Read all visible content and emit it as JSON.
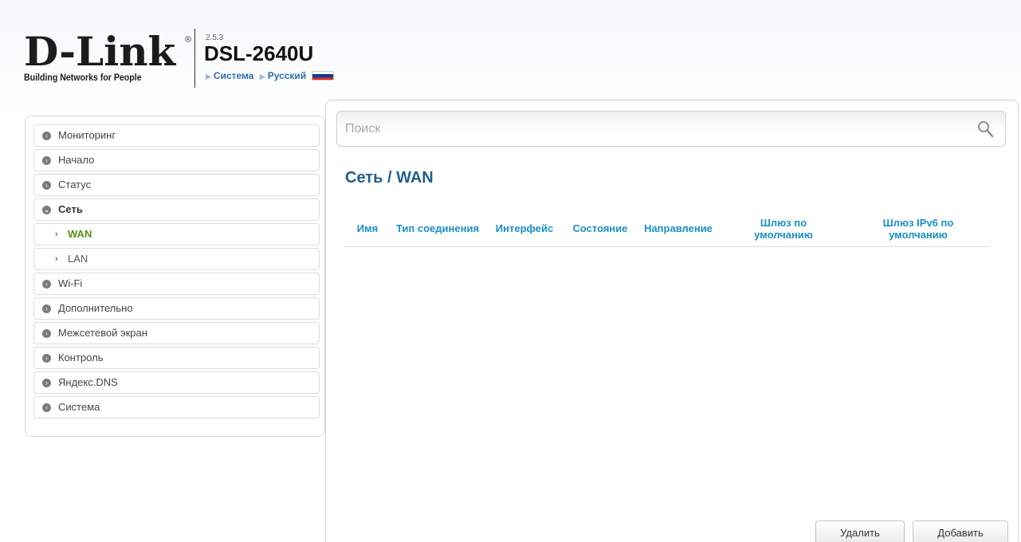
{
  "header": {
    "logo_text": "D-Link",
    "logo_reg": "®",
    "tagline": "Building Networks for People",
    "version": "2.5.3",
    "model": "DSL-2640U",
    "nav": [
      {
        "label": "Система"
      },
      {
        "label": "Русский"
      }
    ],
    "flag_colors": [
      "#ffffff",
      "#0039a6",
      "#d52b1e"
    ]
  },
  "sidebar": {
    "items": [
      {
        "label": "Мониторинг"
      },
      {
        "label": "Начало"
      },
      {
        "label": "Статус"
      },
      {
        "label": "Сеть"
      },
      {
        "label": "WAN"
      },
      {
        "label": "LAN"
      },
      {
        "label": "Wi-Fi"
      },
      {
        "label": "Дополнительно"
      },
      {
        "label": "Межсетевой экран"
      },
      {
        "label": "Контроль"
      },
      {
        "label": "Яндекс.DNS"
      },
      {
        "label": "Система"
      }
    ]
  },
  "search": {
    "placeholder": "Поиск"
  },
  "main": {
    "title": "Сеть /  WAN",
    "columns": [
      "Имя",
      "Тип соединения",
      "Интерфейс",
      "Состояние",
      "Направление",
      "Шлюз по умолчанию",
      "Шлюз IPv6 по умолчанию"
    ],
    "rows": [],
    "delete_label": "Удалить",
    "add_label": "Добавить"
  },
  "colors": {
    "accent": "#1f5f8b",
    "table_header": "#1a8fc9",
    "active_item": "#5c8a1e"
  }
}
